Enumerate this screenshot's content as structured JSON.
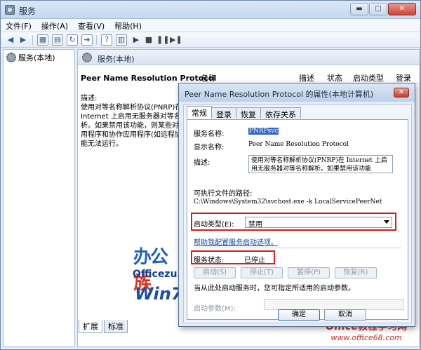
{
  "window": {
    "title": "服务",
    "minimize": "▬",
    "maximize": "□",
    "close": "✕"
  },
  "menu": {
    "items": [
      "文件(F)",
      "操作(A)",
      "查看(V)",
      "帮助(H)"
    ]
  },
  "tree": {
    "root_label": "服务(本地)"
  },
  "services_pane": {
    "header_title": "服务(本地)",
    "selected_service_name": "Peer Name Resolution Protocol",
    "description_label": "描述:",
    "description_text": "使用对等名称解析协议(PNRP)在\nInternet 上启用无服务器对等名\n析。如果禁用该功能，则某些对等\n用程序和协作应用程序(如远程协\n能无法运行。",
    "columns": {
      "name": "名称",
      "description": "描述",
      "status": "状态",
      "startup_type": "启动类型",
      "logon": "登录"
    },
    "bottom_tabs": [
      "扩展",
      "标准"
    ]
  },
  "dialog": {
    "title": "Peer Name Resolution Protocol 的属性(本地计算机)",
    "close": "✕",
    "tabs": [
      "常规",
      "登录",
      "恢复",
      "依存关系"
    ],
    "active_tab": "常规",
    "service_name_label": "服务名称:",
    "service_name_value": "PNRPsvc",
    "display_name_label": "显示名称:",
    "display_name_value": "Peer Name Resolution Protocol",
    "description_label": "描述:",
    "description_value": "使用对等名称解析协议(PNRP)在 Internet 上启用无服务器对等名称解析。如果禁用该功能",
    "exe_path_label": "可执行文件的路径:",
    "exe_path_value": "C:\\Windows\\System32\\svchost.exe -k LocalServicePeerNet",
    "startup_type_label": "启动类型(E):",
    "startup_type_value": "禁用",
    "help_link": "帮助我配置服务启动选项。",
    "status_label": "服务状态:",
    "status_value": "已停止",
    "buttons": {
      "start": "启动(S)",
      "stop": "停止(T)",
      "pause": "暂停(P)",
      "resume": "恢复(R)"
    },
    "hint": "当从此处启动服务时，您可指定所适用的启动参数。",
    "start_params_label": "启动参数(M):",
    "ok": "确定",
    "cancel": "取消"
  },
  "watermarks": {
    "logo_a": "办公",
    "logo_b": "族",
    "site": "Officezu.com",
    "win7_a": "Win7",
    "win7_b": "教程",
    "corner_a": "Office教程学习网",
    "corner_b": "www.office68.com"
  },
  "colors": {
    "highlight_box": "#d91c1c",
    "selection": "#3167c6",
    "link": "#0e47a1"
  }
}
